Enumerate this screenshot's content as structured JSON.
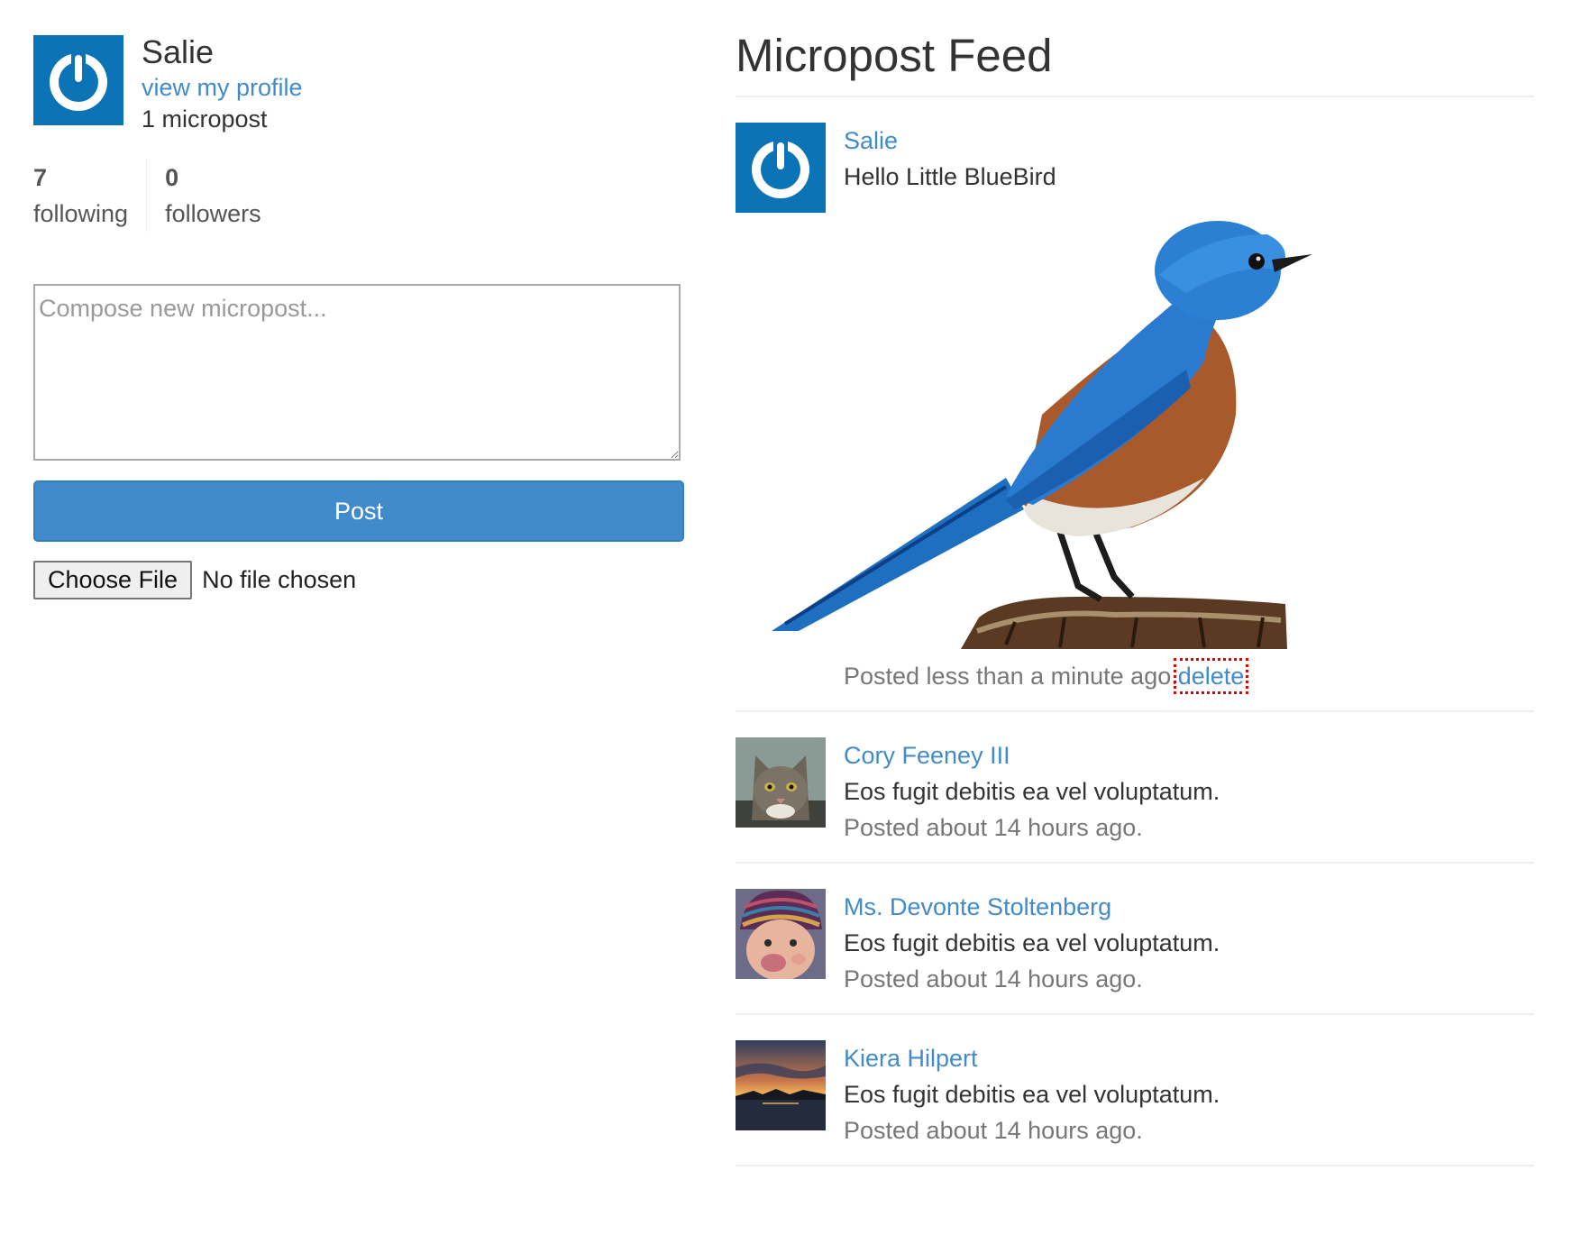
{
  "user": {
    "name": "Salie",
    "profile_link": "view my profile",
    "micropost_count": "1 micropost"
  },
  "stats": {
    "following_count": "7",
    "following_label": "following",
    "followers_count": "0",
    "followers_label": "followers"
  },
  "compose": {
    "placeholder": "Compose new micropost...",
    "post_button": "Post",
    "choose_file_button": "Choose File",
    "file_status": "No file chosen"
  },
  "feed": {
    "title": "Micropost Feed",
    "items": [
      {
        "user": "Salie",
        "content": "Hello Little BlueBird",
        "timestamp": "Posted less than a minute ago.",
        "delete": "delete",
        "avatar": "gravatar-power-icon",
        "image": "bluebird-photo"
      },
      {
        "user": "Cory Feeney III",
        "content": "Eos fugit debitis ea vel voluptatum.",
        "timestamp": "Posted about 14 hours ago.",
        "avatar": "cat-photo"
      },
      {
        "user": "Ms. Devonte Stoltenberg",
        "content": "Eos fugit debitis ea vel voluptatum.",
        "timestamp": "Posted about 14 hours ago.",
        "avatar": "baby-photo"
      },
      {
        "user": "Kiera Hilpert",
        "content": "Eos fugit debitis ea vel voluptatum.",
        "timestamp": "Posted about 14 hours ago.",
        "avatar": "sunset-photo"
      }
    ]
  },
  "colors": {
    "link": "#428bca",
    "button": "#428bca",
    "gravatar_bg": "#0b73b6",
    "muted_text": "#777777",
    "delete_highlight": "#e00000"
  }
}
